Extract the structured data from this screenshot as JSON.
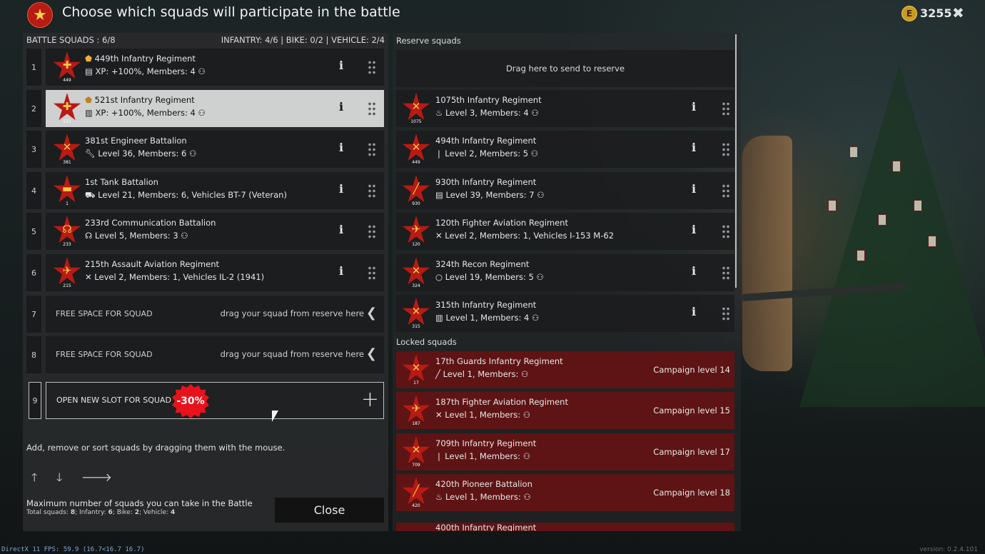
{
  "header": {
    "title": "Choose which squads will participate in the battle",
    "gold": "3255",
    "coin_icon": "E",
    "close_icon": "✖"
  },
  "battle": {
    "title": "BATTLE SQUADS : 6/8",
    "counts": "INFANTRY: 4/6 | BIKE: 0/2 | VEHICLE: 2/4",
    "squads": [
      {
        "num": "1",
        "name": "449th Infantry Regiment",
        "details": "XP: +100%, Members: 4",
        "badge": "449",
        "icon": "rifle"
      },
      {
        "num": "2",
        "name": "521st Infantry Regiment",
        "details": "XP: +100%, Members: 4",
        "badge": "521",
        "icon": "rifle"
      },
      {
        "num": "3",
        "name": "381st Engineer Battalion",
        "details": "Level 36, Members: 6",
        "badge": "381",
        "icon": "wrench"
      },
      {
        "num": "4",
        "name": "1st Tank Battalion",
        "details": "Level 21, Members: 6, Vehicles BT-7 (Veteran)",
        "badge": "1",
        "icon": "tank"
      },
      {
        "num": "5",
        "name": "233rd Communication Battalion",
        "details": "Level 5, Members: 3",
        "badge": "233",
        "icon": "headset"
      },
      {
        "num": "6",
        "name": "215th Assault Aviation Regiment",
        "details": "Level 2, Members: 1, Vehicles IL-2 (1941)",
        "badge": "215",
        "icon": "plane"
      }
    ],
    "free_slots": [
      {
        "num": "7",
        "label": "FREE SPACE FOR SQUAD",
        "hint": "drag your squad from reserve here"
      },
      {
        "num": "8",
        "label": "FREE SPACE FOR SQUAD",
        "hint": "drag your squad from reserve here"
      }
    ],
    "new_slot": {
      "num": "9",
      "label": "OPEN NEW SLOT FOR SQUAD",
      "discount": "-30%"
    },
    "hint": "Add, remove or sort squads by dragging them with the mouse.",
    "max_title": "Maximum number of squads you can take in the Battle",
    "max_total_label": "Total squads:",
    "max_total": "8",
    "max_inf_label": "Infantry:",
    "max_inf": "6",
    "max_bike_label": "Bike:",
    "max_bike": "2",
    "max_veh_label": "Vehicle:",
    "max_veh": "4",
    "close": "Close"
  },
  "reserve": {
    "title": "Reserve squads",
    "drop": "Drag here to send to reserve",
    "squads": [
      {
        "name": "1075th Infantry Regiment",
        "details": "Level 3, Members: 4",
        "badge": "1075"
      },
      {
        "name": "494th Infantry Regiment",
        "details": "Level 2, Members: 5",
        "badge": "449"
      },
      {
        "name": "930th Infantry Regiment",
        "details": "Level 39, Members: 7",
        "badge": "930"
      },
      {
        "name": "120th Fighter Aviation Regiment",
        "details": "Level 2, Members: 1, Vehicles I-153 M-62",
        "badge": "120"
      },
      {
        "name": "324th Recon Regiment",
        "details": "Level 19, Members: 5",
        "badge": "324"
      },
      {
        "name": "315th Infantry Regiment",
        "details": "Level 1, Members: 4",
        "badge": "315"
      }
    ]
  },
  "locked": {
    "title": "Locked squads",
    "squads": [
      {
        "name": "17th Guards Infantry Regiment",
        "details": "Level 1, Members:",
        "level": "Campaign level 14",
        "badge": "17"
      },
      {
        "name": "187th Fighter Aviation Regiment",
        "details": "Level 1, Members:",
        "level": "Campaign level 15",
        "badge": "187"
      },
      {
        "name": "709th Infantry Regiment",
        "details": "Level 1, Members:",
        "level": "Campaign level 17",
        "badge": "709"
      },
      {
        "name": "420th Pioneer Battalion",
        "details": "Level 1, Members:",
        "level": "Campaign level 18",
        "badge": "420"
      }
    ],
    "partial": "400th Infantry Regiment"
  },
  "footer": {
    "fps": "DirectX 11 FPS: 59.9 (16.7<16.7 16.7)",
    "version": "version: 0.2.4.101"
  }
}
